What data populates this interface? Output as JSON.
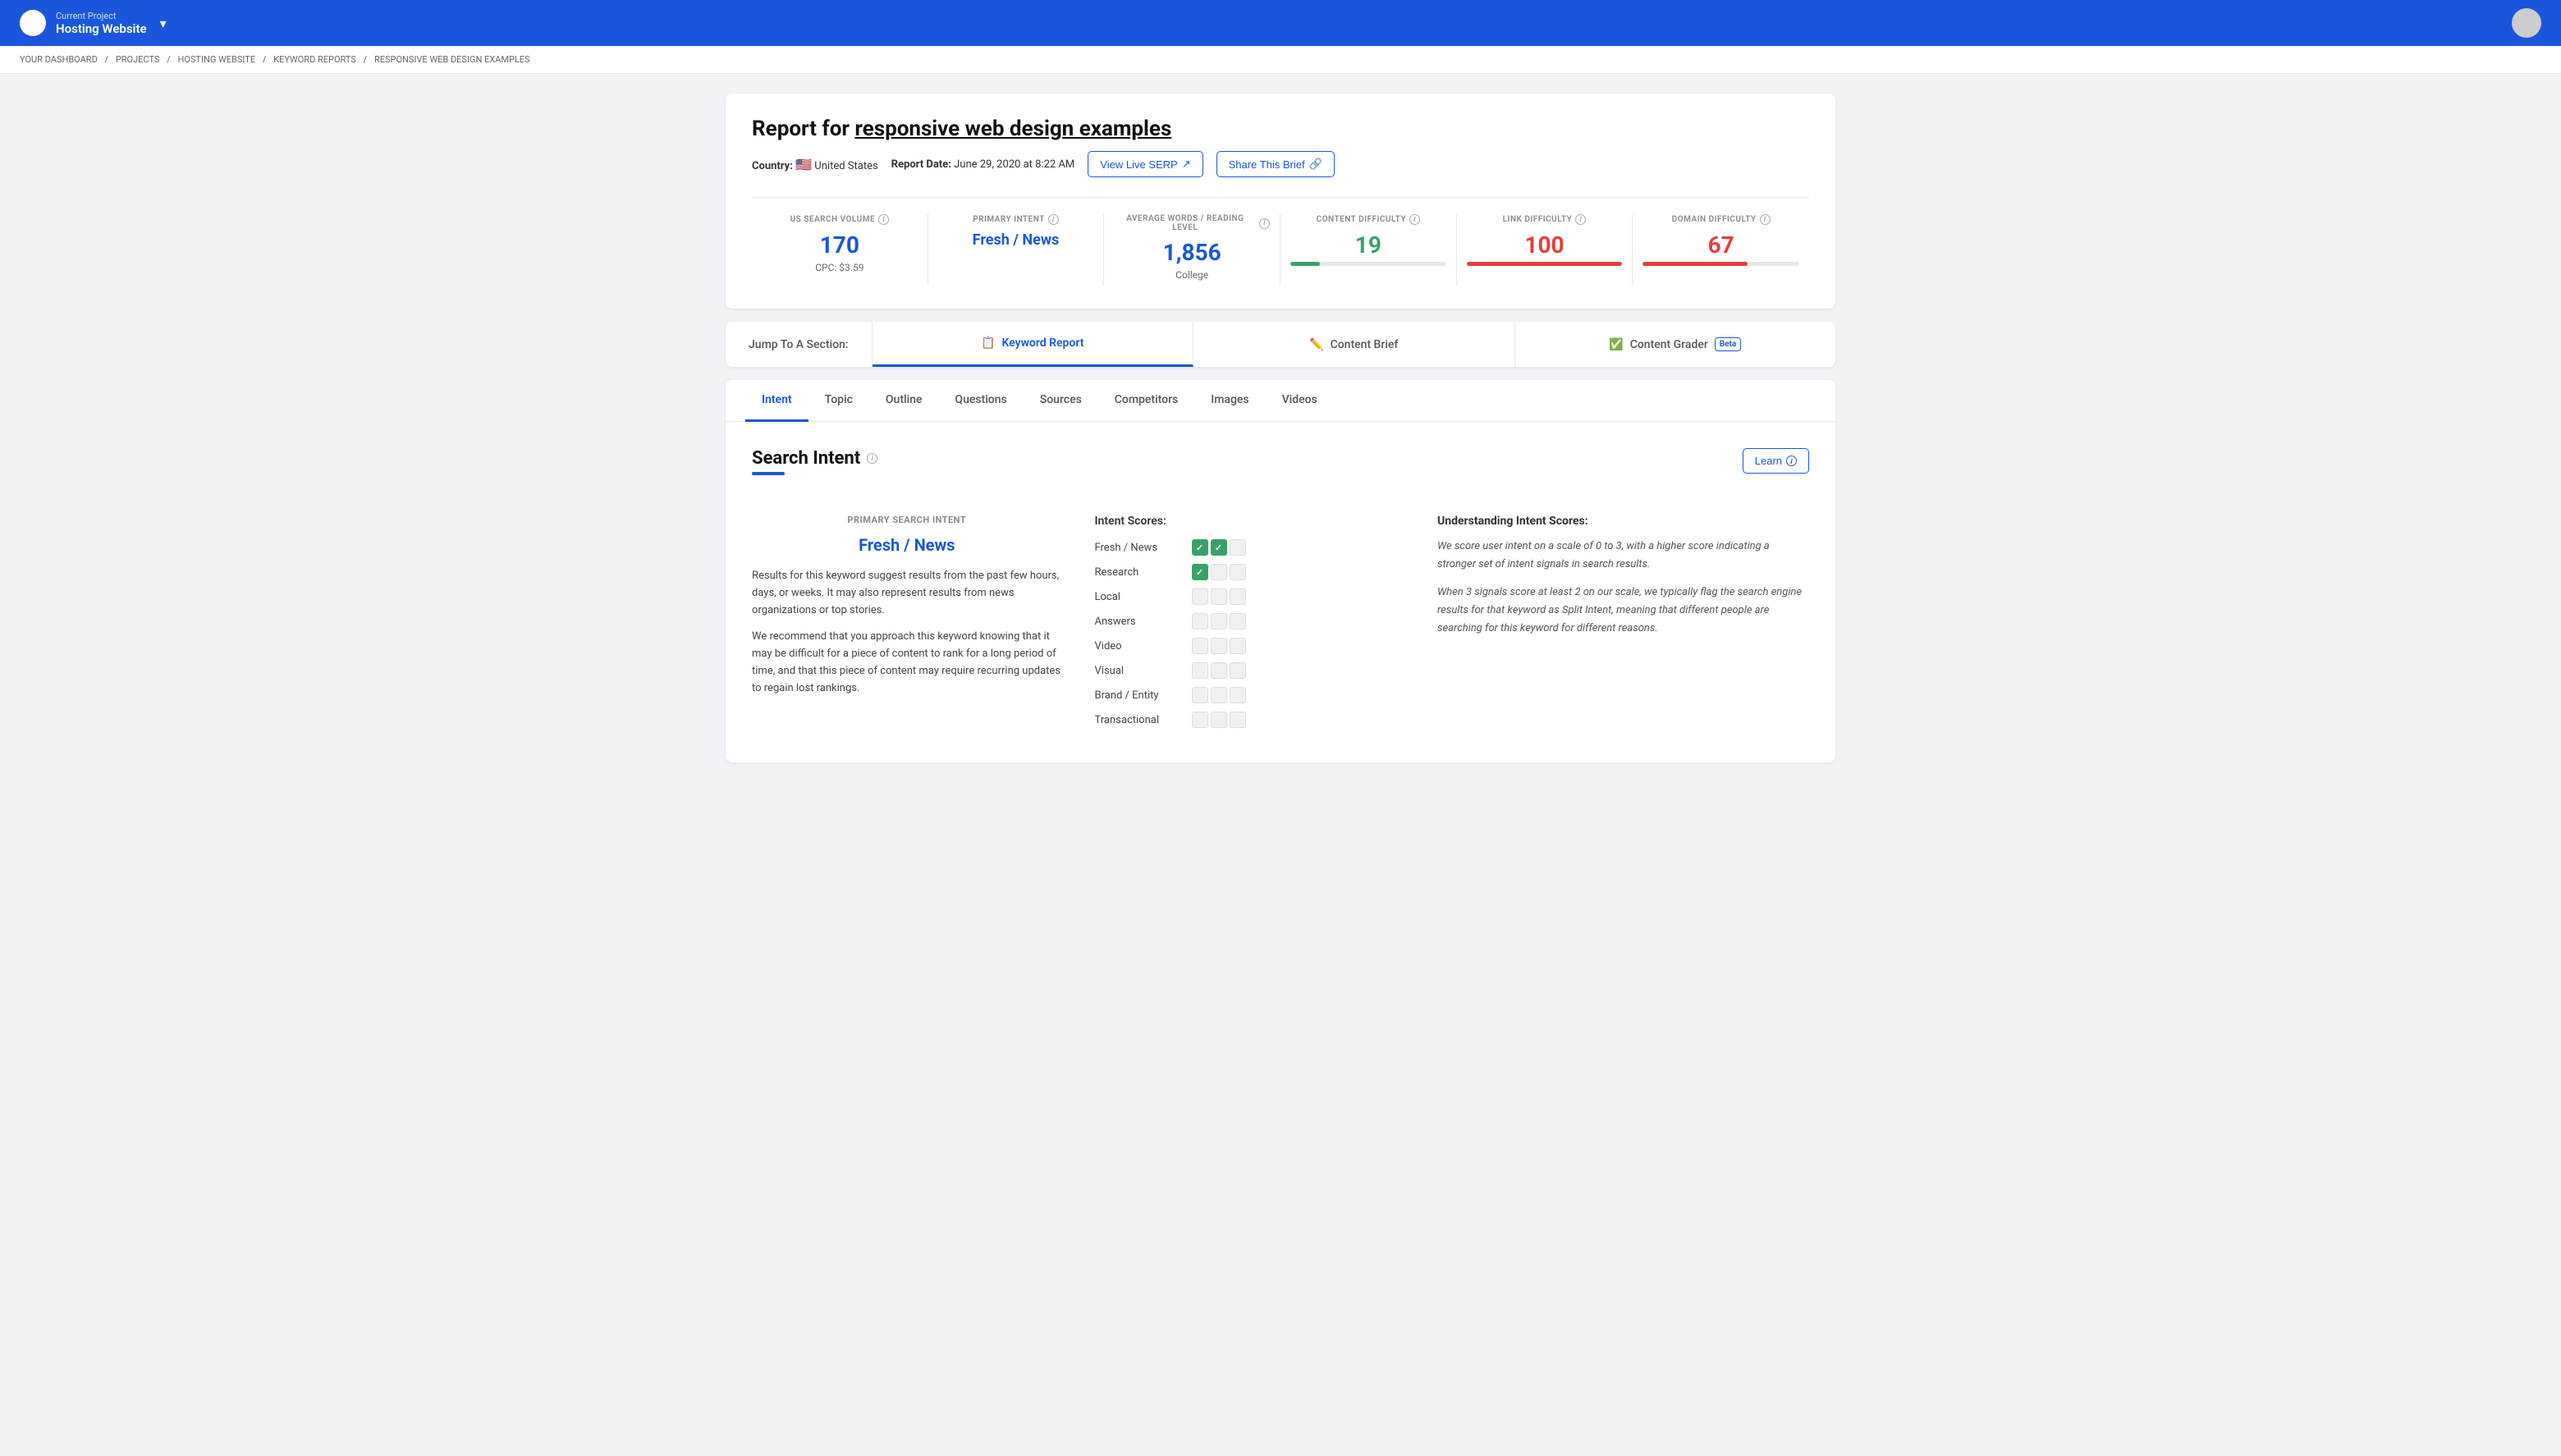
{
  "nav": {
    "project_label": "Current Project",
    "project_name": "Hosting Website",
    "chevron": "▾"
  },
  "breadcrumb": {
    "items": [
      "YOUR DASHBOARD",
      "PROJECTS",
      "HOSTING WEBSITE",
      "KEYWORD REPORTS",
      "RESPONSIVE WEB DESIGN EXAMPLES"
    ]
  },
  "report": {
    "title_prefix": "Report for ",
    "keyword": "responsive web design examples",
    "country_label": "Country:",
    "country_flag": "🇺🇸",
    "country_name": "United States",
    "date_label": "Report Date:",
    "date_value": "June 29, 2020 at 8:22 AM",
    "view_live_serp": "View Live SERP",
    "share_brief": "Share This Brief"
  },
  "stats": [
    {
      "label": "US SEARCH VOLUME",
      "value": "170",
      "sub": "CPC: $3.59",
      "color": "blue",
      "progress": null
    },
    {
      "label": "PRIMARY INTENT",
      "value": "Fresh / News",
      "sub": "",
      "color": "blue",
      "is_link": true,
      "progress": null
    },
    {
      "label": "AVERAGE WORDS / READING LEVEL",
      "value": "1,856",
      "sub": "College",
      "color": "blue",
      "progress": null
    },
    {
      "label": "CONTENT DIFFICULTY",
      "value": "19",
      "sub": "",
      "color": "green",
      "progress": 19,
      "progress_color": "#38a169"
    },
    {
      "label": "LINK DIFFICULTY",
      "value": "100",
      "sub": "",
      "color": "red",
      "progress": 100,
      "progress_color": "#e53e3e"
    },
    {
      "label": "DOMAIN DIFFICULTY",
      "value": "67",
      "sub": "",
      "color": "red",
      "progress": 67,
      "progress_color": "#e53e3e"
    }
  ],
  "jump_tabs": [
    {
      "id": "keyword-report",
      "icon": "📋",
      "label": "Keyword Report",
      "active": true,
      "beta": false
    },
    {
      "id": "content-brief",
      "icon": "✏️",
      "label": "Content Brief",
      "active": false,
      "beta": false
    },
    {
      "id": "content-grader",
      "icon": "✅",
      "label": "Content Grader",
      "active": false,
      "beta": true
    }
  ],
  "jump_label": "Jump To A Section:",
  "sub_tabs": [
    {
      "id": "intent",
      "label": "Intent",
      "active": true
    },
    {
      "id": "topic",
      "label": "Topic",
      "active": false
    },
    {
      "id": "outline",
      "label": "Outline",
      "active": false
    },
    {
      "id": "questions",
      "label": "Questions",
      "active": false
    },
    {
      "id": "sources",
      "label": "Sources",
      "active": false
    },
    {
      "id": "competitors",
      "label": "Competitors",
      "active": false
    },
    {
      "id": "images",
      "label": "Images",
      "active": false
    },
    {
      "id": "videos",
      "label": "Videos",
      "active": false
    }
  ],
  "search_intent": {
    "section_title": "Search Intent",
    "learn_btn": "Learn",
    "primary_label": "PRIMARY SEARCH INTENT",
    "primary_value": "Fresh / News",
    "description_1": "Results for this keyword suggest results from the past few hours, days, or weeks. It may also represent results from news organizations or top stories.",
    "description_2": "We recommend that you approach this keyword knowing that it may be difficult for a piece of content to rank for a long period of time, and that this piece of content may require recurring updates to regain lost rankings.",
    "intent_scores_label": "Intent Scores:",
    "understanding_title": "Understanding Intent Scores:",
    "understanding_1": "We score user intent on a scale of 0 to 3, with a higher score indicating a stronger set of intent signals in search results.",
    "understanding_2": "When 3 signals score at least 2 on our scale, we typically flag the search engine results for that keyword as Split Intent, meaning that different people are searching for this keyword for different reasons.",
    "scores": [
      {
        "name": "Fresh / News",
        "filled": 2
      },
      {
        "name": "Research",
        "filled": 1
      },
      {
        "name": "Local",
        "filled": 0
      },
      {
        "name": "Answers",
        "filled": 0
      },
      {
        "name": "Video",
        "filled": 0
      },
      {
        "name": "Visual",
        "filled": 0
      },
      {
        "name": "Brand / Entity",
        "filled": 0
      },
      {
        "name": "Transactional",
        "filled": 0
      }
    ]
  }
}
